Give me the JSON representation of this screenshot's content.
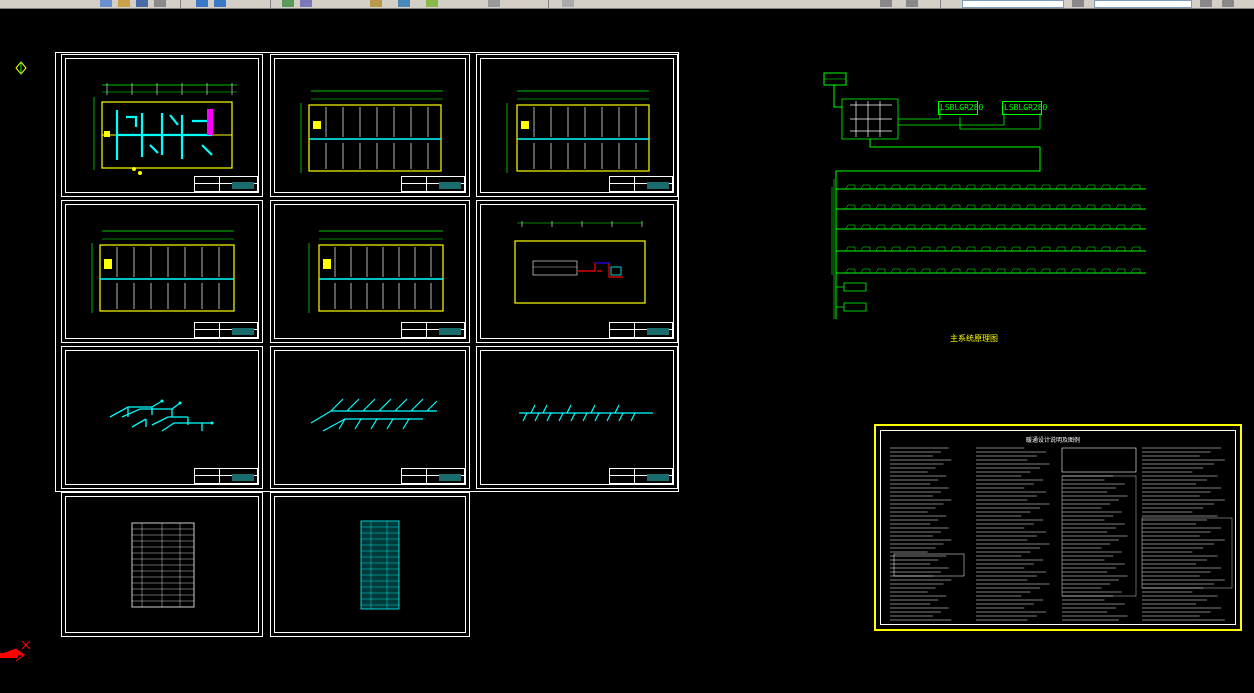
{
  "app": {
    "document_title": ""
  },
  "toolbar": {
    "icons": [
      "new-icon",
      "open-icon",
      "save-icon",
      "print-icon",
      "undo-icon",
      "redo-icon",
      "pan-icon",
      "zoom-icon",
      "properties-icon",
      "layer-icon",
      "match-icon",
      "block-icon"
    ],
    "combo_layer_value": "",
    "combo_style_value": ""
  },
  "riser": {
    "unit_labels": [
      "LSBLGR280",
      "LSBLGR280"
    ],
    "title": "主系统原理图"
  },
  "notes_sheet": {
    "title": "暖通设计说明及图例"
  },
  "colors": {
    "background": "#000000",
    "sheet_border": "#ffffff",
    "pipe": "#00ffff",
    "wall": "#ffff00",
    "riser_line": "#00ff00",
    "accent_red": "#ff0000",
    "accent_magenta": "#ff00ff",
    "notes_frame": "#ffff00"
  },
  "ucs_axes": {
    "x_label": "X",
    "y_label": "Y"
  }
}
